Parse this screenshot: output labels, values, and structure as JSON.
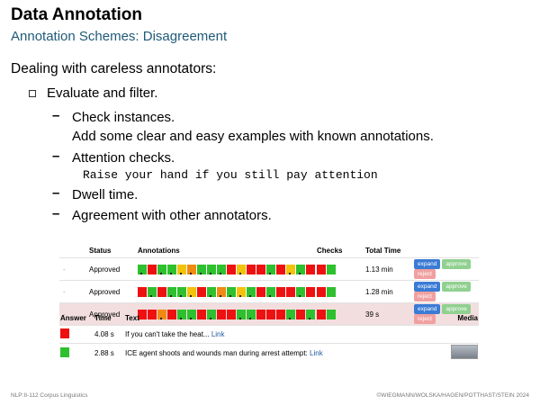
{
  "slide": {
    "title": "Data Annotation",
    "subtitle": "Annotation Schemes: Disagreement",
    "lead": "Dealing with careless annotators:",
    "bullet": "Evaluate and filter.",
    "items": [
      {
        "line1": "Check instances.",
        "line2": "Add some clear and easy examples with known annotations."
      },
      {
        "line1": "Attention checks.",
        "mono": "Raise your hand if you still pay attention"
      },
      {
        "line1": "Dwell time."
      },
      {
        "line1": "Agreement with other annotators."
      }
    ]
  },
  "table1": {
    "headers": [
      "Status",
      "Annotations",
      "Checks",
      "Total Time"
    ],
    "rows": [
      {
        "marker": "-",
        "status": "Approved",
        "total_time": "1.13 min",
        "cells": [
          "g",
          "r",
          "g",
          "g",
          "y",
          "o",
          "g",
          "g",
          "g",
          "r",
          "y",
          "r",
          "r",
          "g",
          "r",
          "y",
          "g",
          "r"
        ],
        "checks": [
          "r",
          "g"
        ]
      },
      {
        "marker": "-",
        "status": "Approved",
        "total_time": "1.28 min",
        "cells": [
          "r",
          "g",
          "r",
          "g",
          "g",
          "y",
          "r",
          "g",
          "o",
          "g",
          "y",
          "g",
          "r",
          "g",
          "r",
          "r",
          "g",
          "r"
        ],
        "checks": [
          "r",
          "g"
        ]
      },
      {
        "marker": "-",
        "status": "Approved",
        "total_time": "39 s",
        "cells": [
          "r",
          "r",
          "o",
          "r",
          "g",
          "g",
          "r",
          "g",
          "r",
          "r",
          "g",
          "g",
          "r",
          "r",
          "r",
          "g",
          "r",
          "g"
        ],
        "checks": [
          "r",
          "g"
        ]
      }
    ],
    "buttons": {
      "expand": "expand",
      "approve": "approve",
      "reject": "reject"
    }
  },
  "table2": {
    "headers": [
      "Answer",
      "Time",
      "Text",
      "Media"
    ],
    "rows": [
      {
        "answer_color": "r",
        "time": "4.08 s",
        "text": "If you can't take the heat...",
        "link": "Link",
        "media": false
      },
      {
        "answer_color": "g",
        "time": "2.88 s",
        "text": "ICE agent shoots and wounds man during arrest attempt:",
        "link": "Link",
        "media": true
      }
    ]
  },
  "footer": {
    "left": "NLP:II-112   Corpus Linguistics",
    "right": "©WIEGMANN/WOLSKA/HAGEN/POTTHAST/STEIN 2024"
  },
  "colors": {
    "g": "#2ec02e",
    "r": "#ee1111",
    "y": "#f2c20c",
    "o": "#f08a14",
    "subtitle": "#1f5a78"
  }
}
